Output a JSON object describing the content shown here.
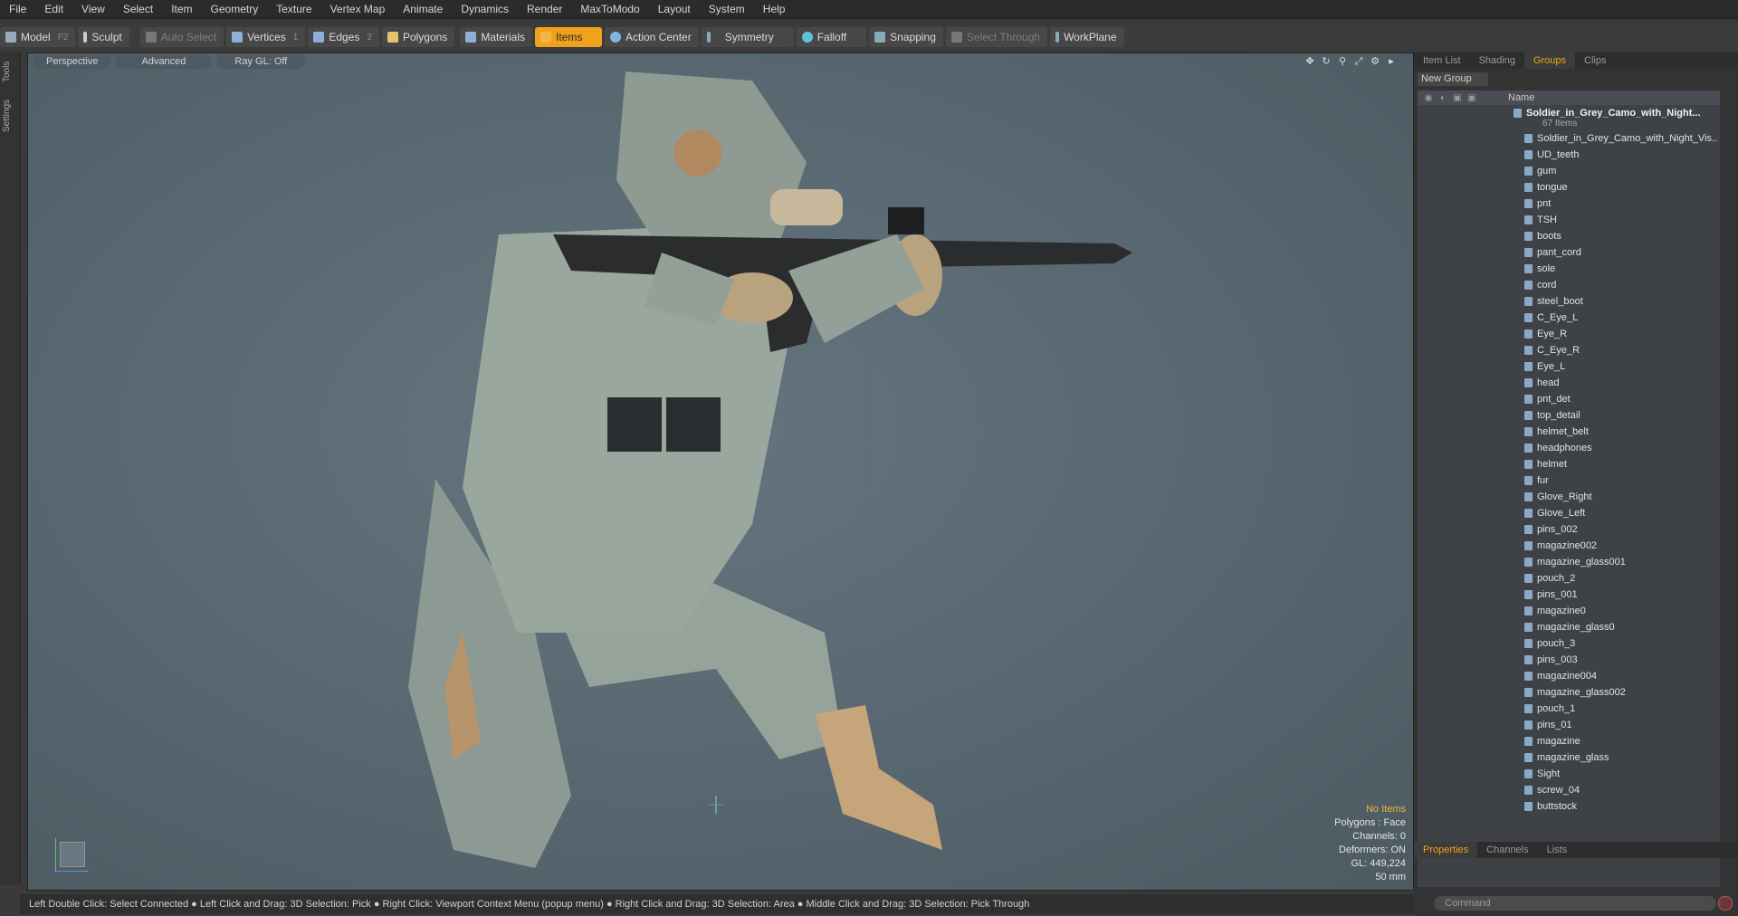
{
  "menu": [
    "File",
    "Edit",
    "View",
    "Select",
    "Item",
    "Geometry",
    "Texture",
    "Vertex Map",
    "Animate",
    "Dynamics",
    "Render",
    "MaxToModo",
    "Layout",
    "System",
    "Help"
  ],
  "toolbar": {
    "model": "Model",
    "model_key": "F2",
    "sculpt": "Sculpt",
    "auto_select": "Auto Select",
    "vertices": "Vertices",
    "vertices_key": "1",
    "edges": "Edges",
    "edges_key": "2",
    "polygons": "Polygons",
    "materials": "Materials",
    "items": "Items",
    "action_center": "Action Center",
    "symmetry": "Symmetry",
    "falloff": "Falloff",
    "snapping": "Snapping",
    "select_through": "Select Through",
    "workplane": "WorkPlane"
  },
  "left_tabs": [
    "Tools",
    "Settings"
  ],
  "viewport": {
    "perspective": "Perspective",
    "advanced": "Advanced",
    "raygl": "Ray GL: Off",
    "hud": {
      "items": "No Items",
      "polygons": "Polygons : Face",
      "channels": "Channels: 0",
      "deformers": "Deformers: ON",
      "gl": "GL: 449,224",
      "lens": "50 mm"
    }
  },
  "status": "Left Double Click: Select Connected ● Left Click and Drag: 3D Selection: Pick ● Right Click: Viewport Context Menu (popup menu) ● Right Click and Drag: 3D Selection: Area ● Middle Click and Drag: 3D Selection: Pick Through",
  "rpanel": {
    "tabs": [
      "Item List",
      "Shading",
      "Groups",
      "Clips"
    ],
    "active_tab": "Groups",
    "new_group": "New Group",
    "name_header": "Name",
    "root": "Soldier_in_Grey_Camo_with_Night...",
    "root_count": "67 Items",
    "items": [
      "Soldier_in_Grey_Camo_with_Night_Vis...",
      "UD_teeth",
      "gum",
      "tongue",
      "pnt",
      "TSH",
      "boots",
      "pant_cord",
      "sole",
      "cord",
      "steel_boot",
      "C_Eye_L",
      "Eye_R",
      "C_Eye_R",
      "Eye_L",
      "head",
      "pnt_det",
      "top_detail",
      "helmet_belt",
      "headphones",
      "helmet",
      "fur",
      "Glove_Right",
      "Glove_Left",
      "pins_002",
      "magazine002",
      "magazine_glass001",
      "pouch_2",
      "pins_001",
      "magazine0",
      "magazine_glass0",
      "pouch_3",
      "pins_003",
      "magazine004",
      "magazine_glass002",
      "pouch_1",
      "pins_01",
      "magazine",
      "magazine_glass",
      "Sight",
      "screw_04",
      "buttstock"
    ],
    "bottom_tabs": [
      "Properties",
      "Channels",
      "Lists"
    ],
    "command": "Command"
  }
}
